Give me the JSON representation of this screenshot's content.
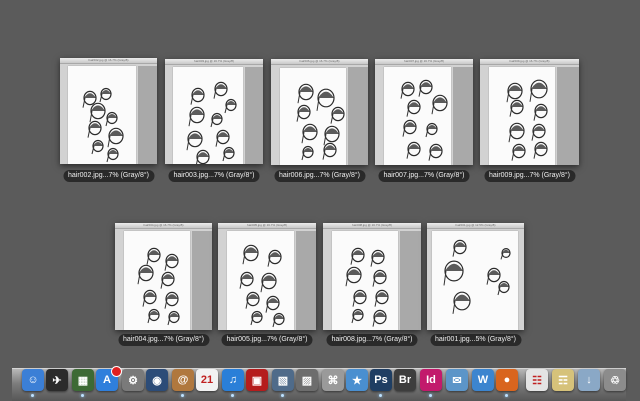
{
  "windows": [
    {
      "label": "hair002.jpg...7% (Gray/8°)",
      "title": "hair002.jpg @ 16.7% (Gray/8)"
    },
    {
      "label": "hair003.jpg...7% (Gray/8°)",
      "title": "hair003.jpg @ 16.7% (Gray/8)"
    },
    {
      "label": "hair006.jpg...7% (Gray/8°)",
      "title": "hair006.jpg @ 16.7% (Gray/8)"
    },
    {
      "label": "hair007.jpg...7% (Gray/8°)",
      "title": "hair007.jpg @ 16.7% (Gray/8)"
    },
    {
      "label": "hair009.jpg...7% (Gray/8°)",
      "title": "hair009.jpg @ 16.7% (Gray/8)"
    },
    {
      "label": "hair004.jpg...7% (Gray/8°)",
      "title": "hair004.jpg @ 16.7% (Gray/8)"
    },
    {
      "label": "hair005.jpg...7% (Gray/8°)",
      "title": "hair005.jpg @ 16.7% (Gray/8)"
    },
    {
      "label": "hair008.jpg...7% (Gray/8°)",
      "title": "hair008.jpg @ 16.7% (Gray/8)"
    },
    {
      "label": "hair001.jpg...5% (Gray/8°)",
      "title": "hair001.jpg @ 12.5% (Gray/8)"
    }
  ],
  "dock": {
    "items": [
      {
        "name": "finder-icon",
        "glyph": "☺",
        "color": "#3b7fd6"
      },
      {
        "name": "launchpad-icon",
        "glyph": "✈",
        "color": "#2b2b2b"
      },
      {
        "name": "mission-control-icon",
        "glyph": "▦",
        "color": "#3d6a35"
      },
      {
        "name": "app-store-icon",
        "glyph": "A",
        "color": "#2f7fdc"
      },
      {
        "name": "system-preferences-icon",
        "glyph": "⚙",
        "color": "#7a7a7a"
      },
      {
        "name": "photo-booth-icon",
        "glyph": "◉",
        "color": "#2c4c78"
      },
      {
        "name": "address-book-icon",
        "glyph": "@",
        "color": "#b0783e"
      },
      {
        "name": "calendar-icon",
        "glyph": "21",
        "color": "#f2f2f2"
      },
      {
        "name": "itunes-icon",
        "glyph": "♫",
        "color": "#2a7fd8"
      },
      {
        "name": "photo-app-icon",
        "glyph": "▣",
        "color": "#b51d1d"
      },
      {
        "name": "image-viewer-icon",
        "glyph": "▧",
        "color": "#4f6b8a"
      },
      {
        "name": "preview-icon",
        "glyph": "▨",
        "color": "#6d6d6d"
      },
      {
        "name": "utility-icon",
        "glyph": "⌘",
        "color": "#9a9a9a"
      },
      {
        "name": "activity-icon",
        "glyph": "★",
        "color": "#4a8fd0"
      },
      {
        "name": "photoshop-icon",
        "glyph": "Ps",
        "color": "#1f3e63"
      },
      {
        "name": "bridge-icon",
        "glyph": "Br",
        "color": "#3d3d3d"
      },
      {
        "name": "indesign-icon",
        "glyph": "Id",
        "color": "#c21a6c"
      },
      {
        "name": "mail-icon",
        "glyph": "✉",
        "color": "#5c95c8"
      },
      {
        "name": "writer-icon",
        "glyph": "W",
        "color": "#3c85cf"
      },
      {
        "name": "firefox-icon",
        "glyph": "●",
        "color": "#d9651e"
      },
      {
        "name": "document-icon",
        "glyph": "☷",
        "color": "#e4e4e4"
      },
      {
        "name": "pdf-file-icon",
        "glyph": "☶",
        "color": "#d6c27a"
      },
      {
        "name": "downloads-folder-icon",
        "glyph": "↓",
        "color": "#8aa8c6"
      },
      {
        "name": "trash-icon",
        "glyph": "♲",
        "color": "#8c8c8c"
      }
    ]
  }
}
